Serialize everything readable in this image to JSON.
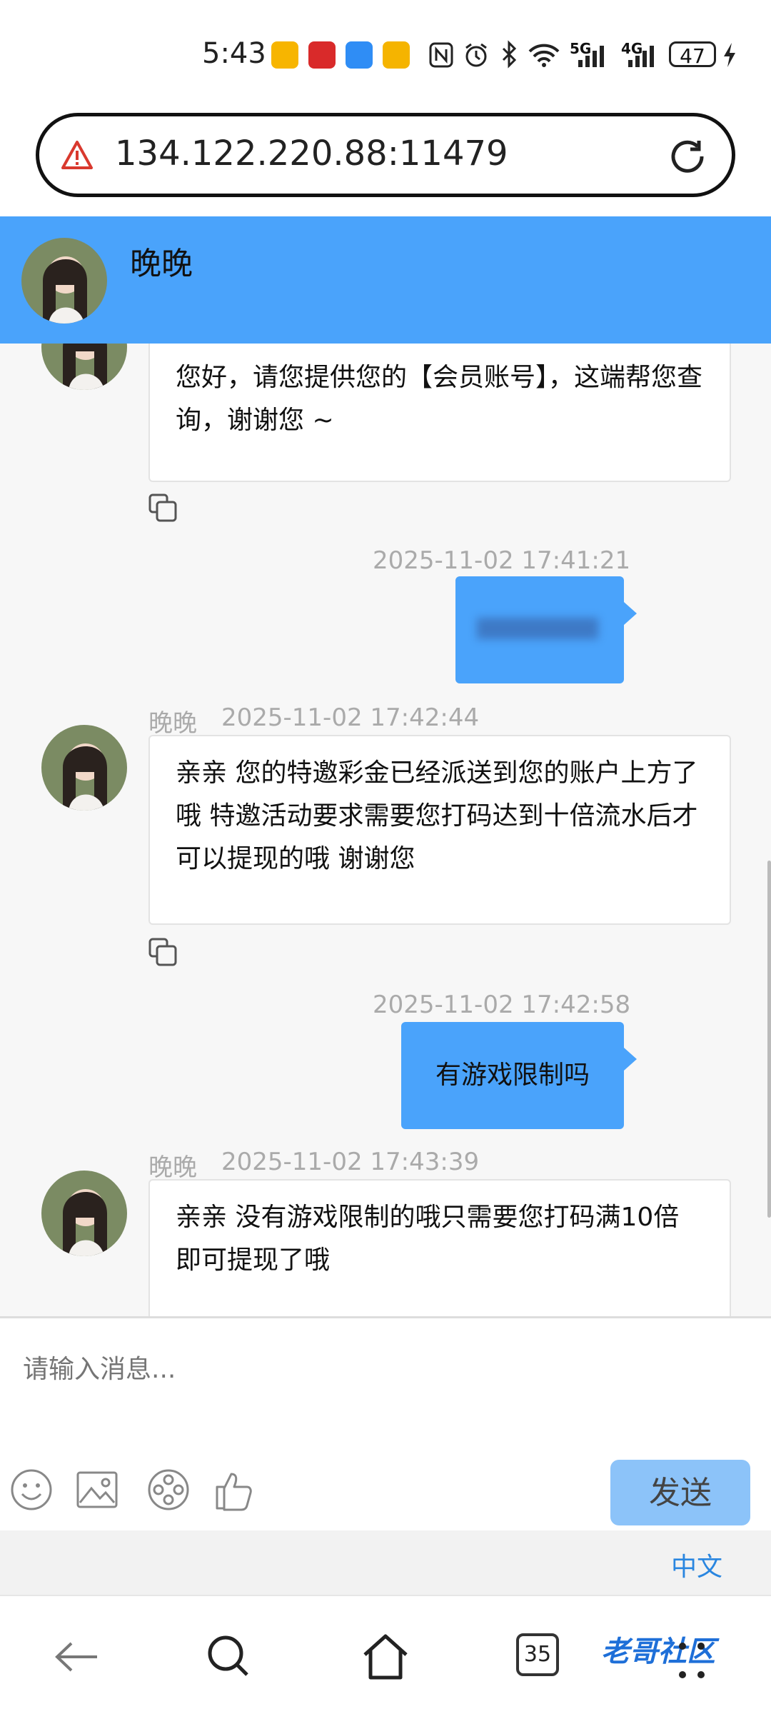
{
  "status_bar": {
    "time": "5:43",
    "battery": "47",
    "network_labels": [
      "5G",
      "4G"
    ]
  },
  "browser": {
    "url": "134.122.220.88:11479",
    "tab_count": "35"
  },
  "chat_header": {
    "name": "晚晚"
  },
  "messages": [
    {
      "side": "left",
      "text": "您好，请您提供您的【会员账号】，这端帮您查询，谢谢您 ~"
    },
    {
      "side": "right",
      "timestamp": "2025-11-02 17:41:21",
      "text": ""
    },
    {
      "side": "left",
      "sender": "晚晚",
      "timestamp": "2025-11-02 17:42:44",
      "text": "亲亲 您的特邀彩金已经派送到您的账户上方了哦 特邀活动要求需要您打码达到十倍流水后才可以提现的哦 谢谢您"
    },
    {
      "side": "right",
      "timestamp": "2025-11-02 17:42:58",
      "text": "有游戏限制吗"
    },
    {
      "side": "left",
      "sender": "晚晚",
      "timestamp": "2025-11-02 17:43:39",
      "text": "亲亲 没有游戏限制的哦只需要您打码满10倍即可提现了哦"
    }
  ],
  "input": {
    "placeholder": "请输入消息...",
    "send_label": "发送",
    "tools": [
      "emoji-icon",
      "image-icon",
      "video-icon",
      "thumbs-up-icon"
    ]
  },
  "language": "中文",
  "watermark": "老哥社区",
  "colors": {
    "accent": "#4aa3fb",
    "send_button": "#8cc3f9",
    "link": "#2a86e0"
  }
}
